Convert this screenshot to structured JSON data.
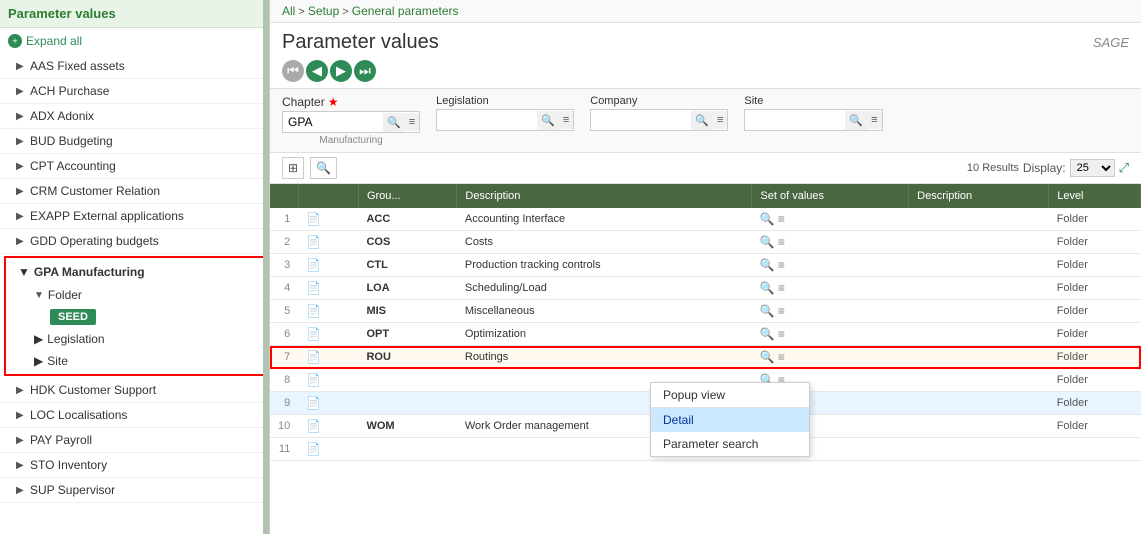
{
  "sidebar": {
    "title": "Parameter values",
    "expand_all": "Expand all",
    "items": [
      {
        "id": "aas",
        "label": "AAS Fixed assets",
        "indent": 1
      },
      {
        "id": "ach",
        "label": "ACH Purchase",
        "indent": 1
      },
      {
        "id": "adx",
        "label": "ADX Adonix",
        "indent": 1
      },
      {
        "id": "bud",
        "label": "BUD Budgeting",
        "indent": 1
      },
      {
        "id": "cpt",
        "label": "CPT Accounting",
        "indent": 1
      },
      {
        "id": "crm",
        "label": "CRM Customer Relation",
        "indent": 1
      },
      {
        "id": "exapp",
        "label": "EXAPP External applications",
        "indent": 1
      },
      {
        "id": "gdd",
        "label": "GDD Operating budgets",
        "indent": 1
      }
    ],
    "gpa_group": {
      "label": "GPA Manufacturing",
      "folder_label": "Folder",
      "seed_badge": "SEED",
      "legislation_label": "Legislation",
      "site_label": "Site"
    },
    "bottom_items": [
      {
        "id": "hdk",
        "label": "HDK Customer Support"
      },
      {
        "id": "loc",
        "label": "LOC Localisations"
      },
      {
        "id": "pay",
        "label": "PAY Payroll"
      },
      {
        "id": "sto",
        "label": "STO Inventory"
      },
      {
        "id": "sup",
        "label": "SUP Supervisor"
      }
    ]
  },
  "breadcrumb": {
    "all": "All",
    "setup": "Setup",
    "general_params": "General parameters"
  },
  "page": {
    "title": "Parameter values",
    "brand": "SAGE"
  },
  "nav_buttons": [
    {
      "id": "first",
      "symbol": "◀◀"
    },
    {
      "id": "prev",
      "symbol": "◀"
    },
    {
      "id": "next",
      "symbol": "▶"
    },
    {
      "id": "last",
      "symbol": "▶▶"
    }
  ],
  "filters": {
    "chapter": {
      "label": "Chapter",
      "required": true,
      "value": "GPA",
      "hint": "Manufacturing"
    },
    "legislation": {
      "label": "Legislation",
      "value": ""
    },
    "company": {
      "label": "Company",
      "value": ""
    },
    "site": {
      "label": "Site",
      "value": ""
    }
  },
  "toolbar": {
    "results_label": "10 Results",
    "display_label": "Display:",
    "display_value": "25"
  },
  "table": {
    "columns": [
      "",
      "",
      "Grou...",
      "Description",
      "Set of values",
      "Description",
      "Level"
    ],
    "rows": [
      {
        "num": 1,
        "code": "ACC",
        "description": "Accounting Interface",
        "level": "Folder"
      },
      {
        "num": 2,
        "code": "COS",
        "description": "Costs",
        "level": "Folder"
      },
      {
        "num": 3,
        "code": "CTL",
        "description": "Production tracking controls",
        "level": "Folder"
      },
      {
        "num": 4,
        "code": "LOA",
        "description": "Scheduling/Load",
        "level": "Folder"
      },
      {
        "num": 5,
        "code": "MIS",
        "description": "Miscellaneous",
        "level": "Folder"
      },
      {
        "num": 6,
        "code": "OPT",
        "description": "Optimization",
        "level": "Folder"
      },
      {
        "num": 7,
        "code": "ROU",
        "description": "Routings",
        "level": "Folder",
        "highlighted": true
      },
      {
        "num": 8,
        "code": "",
        "description": "",
        "level": "Folder"
      },
      {
        "num": 9,
        "code": "",
        "description": "",
        "level": "Folder"
      },
      {
        "num": 10,
        "code": "WOM",
        "description": "Work Order management",
        "level": "Folder"
      },
      {
        "num": 11,
        "code": "",
        "description": "",
        "level": ""
      }
    ]
  },
  "context_menu": {
    "items": [
      {
        "id": "popup",
        "label": "Popup view"
      },
      {
        "id": "detail",
        "label": "Detail",
        "selected": true
      },
      {
        "id": "param_search",
        "label": "Parameter search"
      }
    ]
  }
}
